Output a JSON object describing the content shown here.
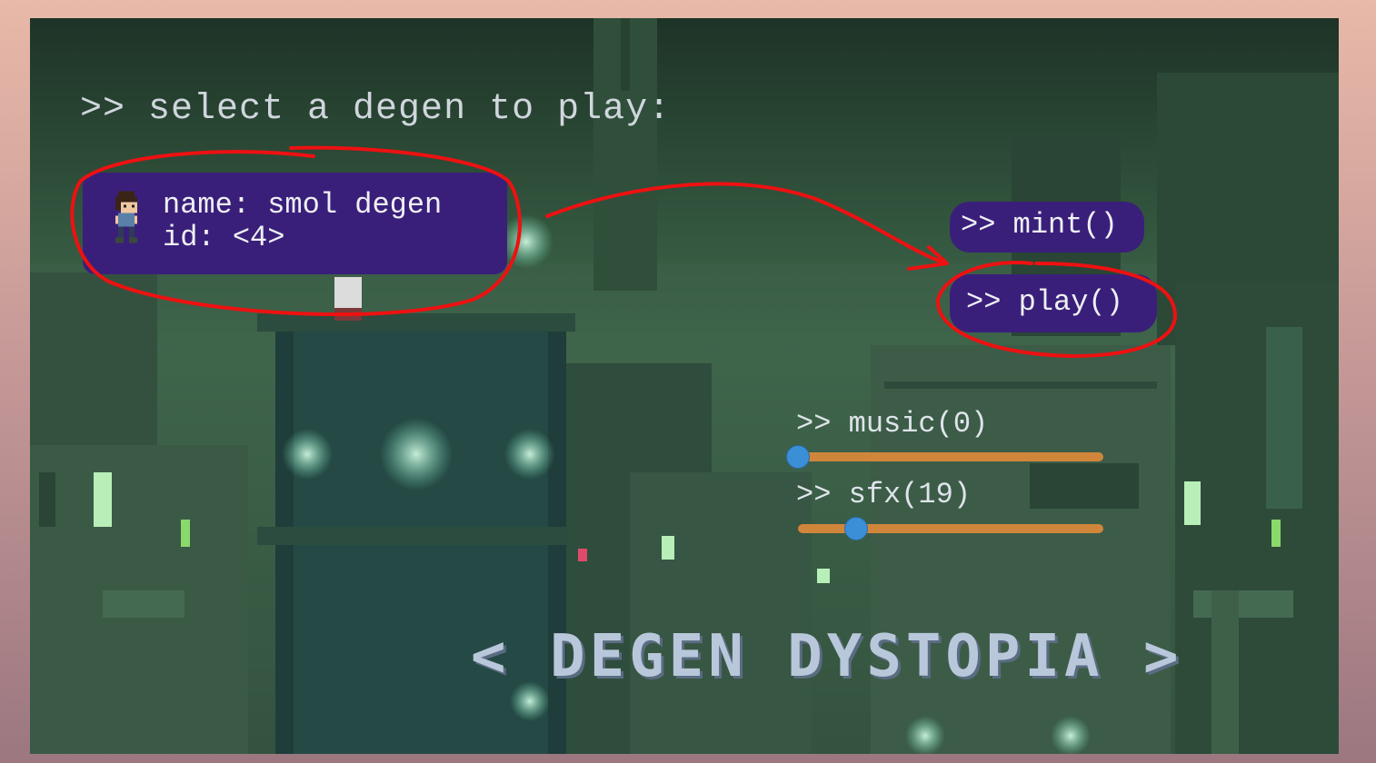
{
  "header": {
    "prompt": ">> select a degen to play:"
  },
  "selected_degen": {
    "name_line": "name: smol degen",
    "id_line": "id: <4>"
  },
  "buttons": {
    "mint": ">> mint()",
    "play": ">> play()"
  },
  "volume": {
    "music_label": ">> music(0)",
    "music_level": 0,
    "sfx_label": ">> sfx(19)",
    "sfx_level": 19
  },
  "title": "< DEGEN DYSTOPIA >",
  "colors": {
    "panel_purple": "#3a1f7a",
    "slider_orange": "#d0863a",
    "knob_blue": "#3b8fd6",
    "annotation_red": "#ee1111",
    "title_blue": "#b9c7db"
  },
  "icons": {
    "avatar": "pixel-character-icon"
  }
}
